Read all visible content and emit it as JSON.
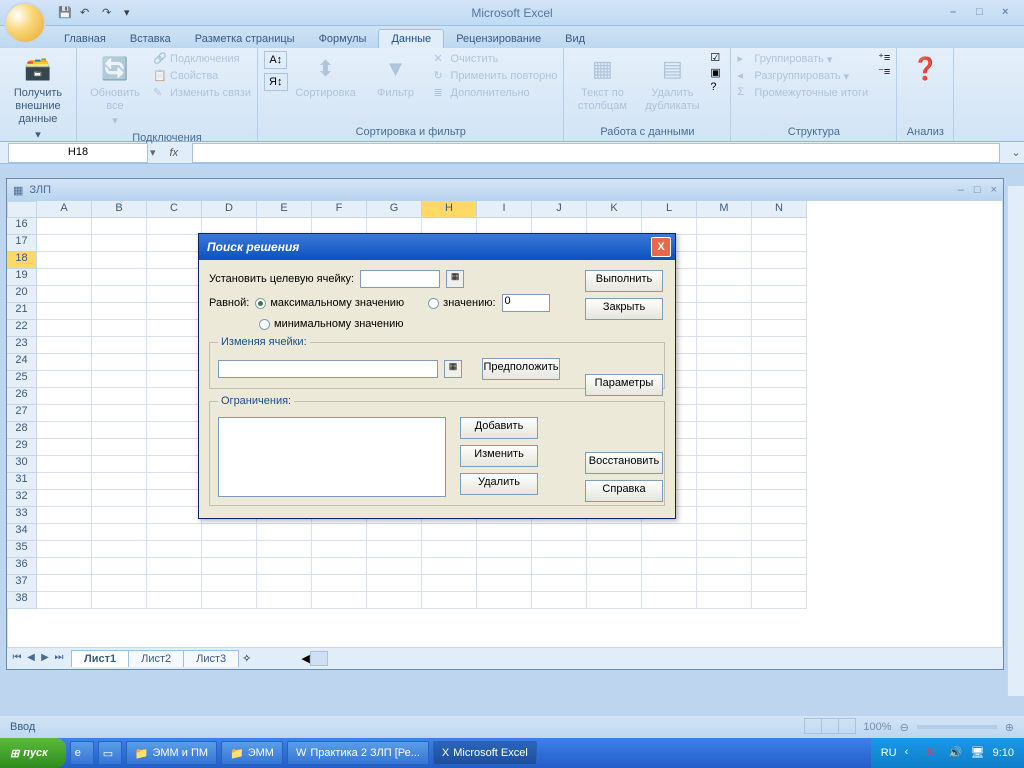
{
  "app": {
    "title": "Microsoft Excel"
  },
  "tabs": {
    "home": "Главная",
    "insert": "Вставка",
    "layout": "Разметка страницы",
    "formulas": "Формулы",
    "data": "Данные",
    "review": "Рецензирование",
    "view": "Вид"
  },
  "ribbon": {
    "external": "Получить внешние данные",
    "refresh": "Обновить все",
    "conn": "Подключения",
    "props": "Свойства",
    "editlinks": "Изменить связи",
    "connections_group": "Подключения",
    "sort": "Сортировка",
    "filter": "Фильтр",
    "clear": "Очистить",
    "reapply": "Применить повторно",
    "advanced": "Дополнительно",
    "sortfilter_group": "Сортировка и фильтр",
    "textcol": "Текст по столбцам",
    "dedup": "Удалить дубликаты",
    "datatools_group": "Работа с данными",
    "group": "Группировать",
    "ungroup": "Разгруппировать",
    "subtotal": "Промежуточные итоги",
    "outline_group": "Структура",
    "analysis_group": "Анализ"
  },
  "namebox": "H18",
  "workbook": {
    "title": "ЗЛП"
  },
  "columns": [
    "A",
    "B",
    "C",
    "D",
    "E",
    "F",
    "G",
    "H",
    "I",
    "J",
    "K",
    "L",
    "M",
    "N"
  ],
  "rows": [
    "16",
    "17",
    "18",
    "19",
    "20",
    "21",
    "22",
    "23",
    "24",
    "25",
    "26",
    "27",
    "28",
    "29",
    "30",
    "31",
    "32",
    "33",
    "34",
    "35",
    "36",
    "37",
    "38"
  ],
  "sheets": {
    "s1": "Лист1",
    "s2": "Лист2",
    "s3": "Лист3"
  },
  "statusbar": {
    "mode": "Ввод",
    "zoom": "100%"
  },
  "dialog": {
    "title": "Поиск решения",
    "target_label": "Установить целевую ячейку:",
    "equal": "Равной:",
    "max": "максимальному значению",
    "min": "минимальному значению",
    "value_label": "значению:",
    "value": "0",
    "changing": "Изменяя ячейки:",
    "constraints": "Ограничения:",
    "btn_solve": "Выполнить",
    "btn_close": "Закрыть",
    "btn_guess": "Предположить",
    "btn_options": "Параметры",
    "btn_add": "Добавить",
    "btn_change": "Изменить",
    "btn_delete": "Удалить",
    "btn_reset": "Восстановить",
    "btn_help": "Справка"
  },
  "taskbar": {
    "start": "пуск",
    "t1": "ЭММ и ПМ",
    "t2": "ЭММ",
    "t3": "Практика 2 ЗЛП [Ре...",
    "t4": "Microsoft Excel",
    "lang": "RU",
    "clock": "9:10"
  }
}
